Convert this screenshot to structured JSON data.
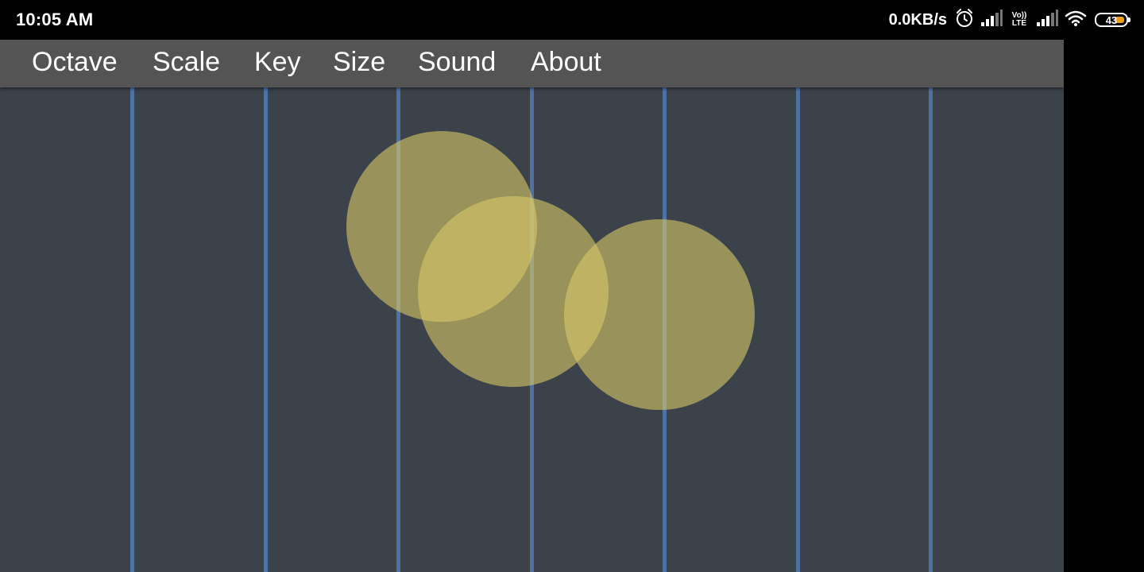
{
  "status_bar": {
    "time": "10:05 AM",
    "net_speed": "0.0KB/s",
    "volte_top": "Vo))",
    "volte_bottom": "LTE",
    "battery": "43",
    "icons": [
      "alarm-icon",
      "signal-icon",
      "volte-lte-icon",
      "signal-icon",
      "wifi-icon",
      "battery-icon"
    ]
  },
  "menu": {
    "items": [
      "Octave",
      "Scale",
      "Key",
      "Size",
      "Sound",
      "About"
    ]
  },
  "colors": {
    "background": "#3b424a",
    "menubar": "#545454",
    "string": "#4f72a6",
    "touch": "#d8c868",
    "battery_accent": "#f0a018"
  }
}
